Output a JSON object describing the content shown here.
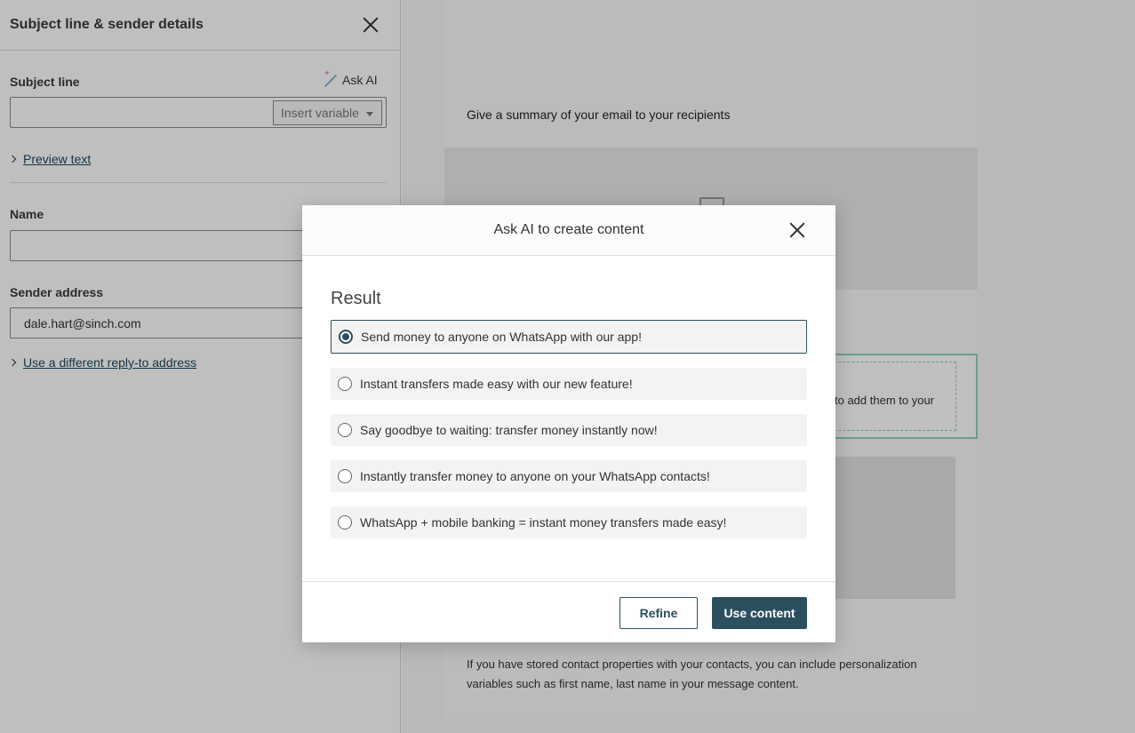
{
  "panel": {
    "title": "Subject line & sender details",
    "subject_label": "Subject line",
    "ask_ai_label": "Ask AI",
    "subject_value": "",
    "insert_variable_label": "Insert variable",
    "preview_text_link": "Preview text",
    "name_label": "Name",
    "name_value": "",
    "sender_label": "Sender address",
    "sender_value": "dale.hart@sinch.com",
    "reply_to_link": "Use a different reply-to address"
  },
  "canvas": {
    "summary_text": "Give a summary of your email to your recipients",
    "partial_text": "to add them to your",
    "bottom_text": "If you have stored contact properties with your contacts, you can include personalization variables such as first name, last name in your message content."
  },
  "modal": {
    "title": "Ask AI to create content",
    "result_heading": "Result",
    "options": [
      {
        "label": "Send money to anyone on WhatsApp with our app!",
        "selected": true
      },
      {
        "label": "Instant transfers made easy with our new feature!",
        "selected": false
      },
      {
        "label": "Say goodbye to waiting: transfer money instantly now!",
        "selected": false
      },
      {
        "label": "Instantly transfer money to anyone on your WhatsApp contacts!",
        "selected": false
      },
      {
        "label": "WhatsApp + mobile banking = instant money transfers made easy!",
        "selected": false
      }
    ],
    "refine_label": "Refine",
    "use_content_label": "Use content"
  },
  "colors": {
    "primary": "#2c4f5e",
    "link": "#1d4a5c",
    "accent_green": "#8fd2c0"
  }
}
